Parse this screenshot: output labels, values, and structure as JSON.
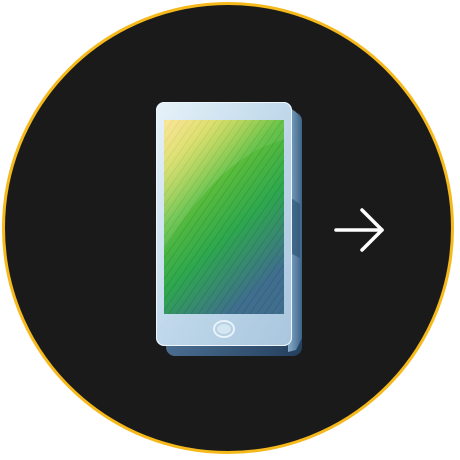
{
  "icon": {
    "name": "smartphone-icon",
    "arrow_icon": "arrow-right-icon"
  },
  "colors": {
    "background": "#1a1a1a",
    "ring": "#f5b91c",
    "arrow": "#ffffff",
    "screen_top": "#f2c21a",
    "screen_mid": "#3cb24a",
    "screen_bottom": "#3a6a8a",
    "phone_body": "#c9dfee",
    "phone_shadow": "#2a4a6a"
  }
}
